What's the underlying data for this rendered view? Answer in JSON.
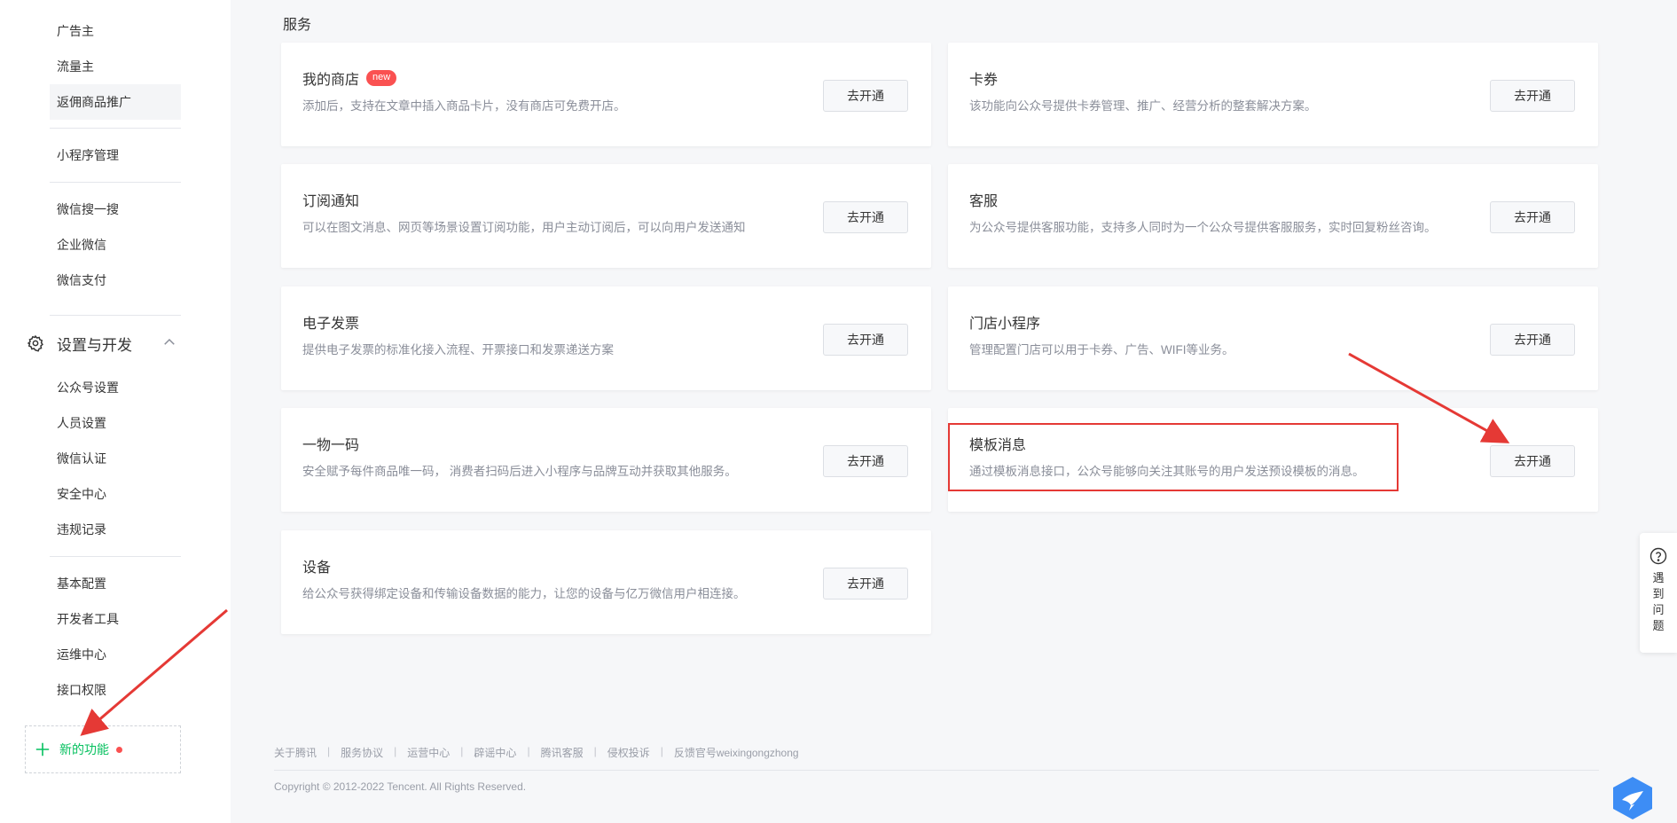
{
  "sidebar": {
    "items": [
      {
        "label": "广告主"
      },
      {
        "label": "流量主"
      },
      {
        "label": "返佣商品推广"
      },
      {
        "label": "小程序管理"
      },
      {
        "label": "微信搜一搜"
      },
      {
        "label": "企业微信"
      },
      {
        "label": "微信支付"
      }
    ],
    "section": {
      "label": "设置与开发",
      "icon": "gear-icon",
      "expanded": true
    },
    "settings_items": [
      {
        "label": "公众号设置"
      },
      {
        "label": "人员设置"
      },
      {
        "label": "微信认证"
      },
      {
        "label": "安全中心"
      },
      {
        "label": "违规记录"
      },
      {
        "label": "基本配置"
      },
      {
        "label": "开发者工具"
      },
      {
        "label": "运维中心"
      },
      {
        "label": "接口权限"
      }
    ],
    "new_feature": {
      "label": "新的功能",
      "icon": "plus-icon"
    }
  },
  "main": {
    "title": "服务",
    "cards": [
      {
        "title": "我的商店",
        "badge": "new",
        "desc": "添加后，支持在文章中插入商品卡片，没有商店可免费开店。",
        "button": "去开通"
      },
      {
        "title": "卡券",
        "desc": "该功能向公众号提供卡券管理、推广、经营分析的整套解决方案。",
        "button": "去开通"
      },
      {
        "title": "订阅通知",
        "desc": "可以在图文消息、网页等场景设置订阅功能，用户主动订阅后，可以向用户发送通知",
        "button": "去开通"
      },
      {
        "title": "客服",
        "desc": "为公众号提供客服功能，支持多人同时为一个公众号提供客服服务，实时回复粉丝咨询。",
        "button": "去开通"
      },
      {
        "title": "电子发票",
        "desc": "提供电子发票的标准化接入流程、开票接口和发票递送方案",
        "button": "去开通"
      },
      {
        "title": "门店小程序",
        "desc": "管理配置门店可以用于卡券、广告、WIFI等业务。",
        "button": "去开通"
      },
      {
        "title": "一物一码",
        "desc": "安全赋予每件商品唯一码， 消费者扫码后进入小程序与品牌互动并获取其他服务。",
        "button": "去开通"
      },
      {
        "title": "模板消息",
        "desc": "通过模板消息接口，公众号能够向关注其账号的用户发送预设模板的消息。",
        "button": "去开通"
      },
      {
        "title": "设备",
        "desc": "给公众号获得绑定设备和传输设备数据的能力，让您的设备与亿万微信用户相连接。",
        "button": "去开通"
      }
    ]
  },
  "footer": {
    "links": [
      "关于腾讯",
      "服务协议",
      "运营中心",
      "辟谣中心",
      "腾讯客服",
      "侵权投诉",
      "反馈官号weixingongzhong"
    ],
    "copyright": "Copyright © 2012-2022 Tencent. All Rights Reserved."
  },
  "help": {
    "label": "遇到问题",
    "icon": "question-icon"
  },
  "colors": {
    "accent_green": "#07c160",
    "badge_red": "#fa5151",
    "annotation_red": "#e53935"
  }
}
